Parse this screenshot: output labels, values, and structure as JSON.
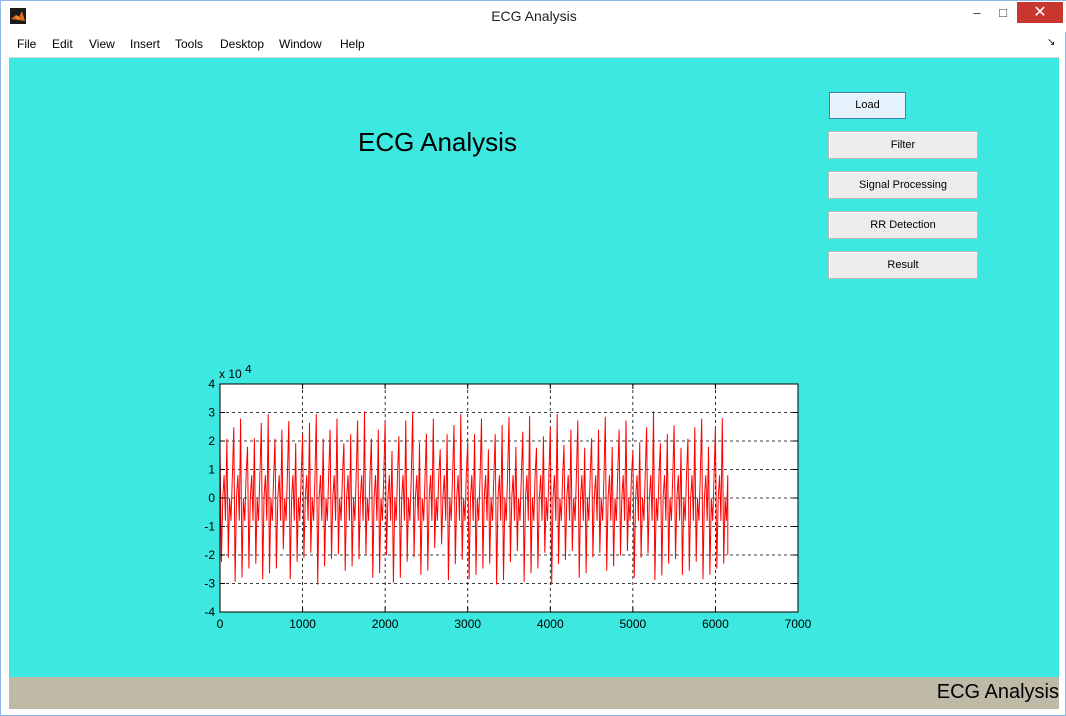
{
  "window": {
    "title": "ECG Analysis",
    "controls": {
      "minimize": "–",
      "maximize": "□",
      "close": "✕"
    }
  },
  "menubar": {
    "items": [
      "File",
      "Edit",
      "View",
      "Insert",
      "Tools",
      "Desktop",
      "Window",
      "Help"
    ],
    "dock_arrow": "↘"
  },
  "figure": {
    "background": "#3ce8e0",
    "title": "ECG Analysis",
    "buttons": {
      "load": "Load",
      "filter": "Filter",
      "signal_processing": "Signal Processing",
      "rr_detection": "RR Detection",
      "result": "Result"
    },
    "status_text": "ECG Analysis"
  },
  "chart_data": {
    "type": "line",
    "title": "",
    "xlabel": "",
    "ylabel": "",
    "xlim": [
      0,
      7000
    ],
    "ylim": [
      -4,
      4
    ],
    "x_ticks": [
      0,
      1000,
      2000,
      3000,
      4000,
      5000,
      6000,
      7000
    ],
    "y_ticks": [
      -4,
      -3,
      -2,
      -1,
      0,
      1,
      2,
      3,
      4
    ],
    "y_exponent_label": "x 10",
    "y_exponent_power": "4",
    "grid": true,
    "grid_style": "dashed",
    "line_color": "#ff0000",
    "series": [
      {
        "x": [
          0,
          150,
          300,
          450,
          600,
          750,
          900,
          1050,
          1200,
          1350,
          1500,
          1650,
          1800,
          1950,
          2100,
          2250,
          2400,
          2550,
          2700,
          2850,
          3000,
          3150,
          3300,
          3450,
          3600,
          3750,
          3900,
          4050,
          4200,
          4350,
          4500,
          4650,
          4800,
          4950,
          5100,
          5250,
          5400,
          5550,
          5700,
          5850,
          6000,
          6150
        ],
        "y_max": [
          3.2,
          3.1,
          3.0,
          3.1,
          3.2,
          3.0,
          3.2,
          3.1,
          3.2,
          3.1,
          3.2,
          3.2,
          3.2,
          3.0,
          3.1,
          3.2,
          3.0,
          3.1,
          3.2,
          3.1,
          3.0,
          3.1,
          3.2,
          3.0,
          3.1,
          3.2,
          3.1,
          3.1,
          3.2,
          3.2,
          3.0,
          3.0,
          3.2,
          3.0,
          3.1,
          3.2,
          3.0,
          3.2,
          3.1,
          3.0,
          3.3,
          0.0
        ],
        "y_min": [
          -3.0,
          -3.1,
          -3.3,
          -3.0,
          -3.3,
          -3.0,
          -2.8,
          -3.2,
          -3.0,
          -3.3,
          -3.0,
          -3.3,
          -3.3,
          -3.1,
          -3.3,
          -3.2,
          -3.0,
          -2.5,
          -3.2,
          -3.1,
          -3.0,
          -3.3,
          -3.2,
          -3.0,
          -3.1,
          -3.3,
          -3.2,
          -2.9,
          -3.1,
          -3.3,
          -3.2,
          -3.0,
          -3.1,
          -3.3,
          -3.0,
          -3.2,
          -3.3,
          -3.0,
          -3.2,
          -3.0,
          -3.3,
          -2.0
        ]
      }
    ]
  }
}
